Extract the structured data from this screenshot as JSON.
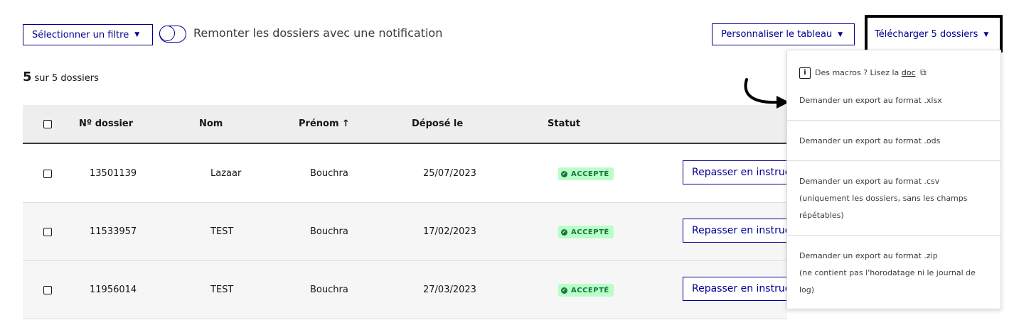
{
  "toolbar": {
    "filter_label": "Sélectionner un filtre",
    "notification_toggle_label": "Remonter les dossiers avec une notification",
    "customize_label": "Personnaliser le tableau",
    "download_label": "Télécharger 5 dossiers"
  },
  "summary": {
    "count": "5",
    "text": "sur 5 dossiers"
  },
  "table": {
    "columns": [
      "Nº dossier",
      "Nom",
      "Prénom ↑",
      "Déposé le",
      "Statut"
    ],
    "rows": [
      {
        "number": "13501139",
        "nom": "Lazaar",
        "prenom": "Bouchra",
        "date": "25/07/2023",
        "statut": "ACCEPTÉ",
        "action": "Repasser en instruction"
      },
      {
        "number": "11533957",
        "nom": "TEST",
        "prenom": "Bouchra",
        "date": "17/02/2023",
        "statut": "ACCEPTÉ",
        "action": "Repasser en instruction"
      },
      {
        "number": "11956014",
        "nom": "TEST",
        "prenom": "Bouchra",
        "date": "27/03/2023",
        "statut": "ACCEPTÉ",
        "action": "Repasser en instruction"
      }
    ]
  },
  "dropdown": {
    "macros_text": "Des macros ? Lisez la",
    "doc_link": "doc",
    "export_xlsx": "Demander un export au format .xlsx",
    "export_ods": "Demander un export au format .ods",
    "export_csv": "Demander un export au format .csv",
    "export_csv_note_1": "(uniquement les dossiers, sans les champs",
    "export_csv_note_2": "répétables)",
    "export_zip": "Demander un export au format .zip",
    "export_zip_note_1": "(ne contient pas l'horodatage ni le journal de",
    "export_zip_note_2": "log)"
  },
  "colors": {
    "primary": "#000091",
    "success_bg": "#b8fec9",
    "success_text": "#18753c"
  }
}
